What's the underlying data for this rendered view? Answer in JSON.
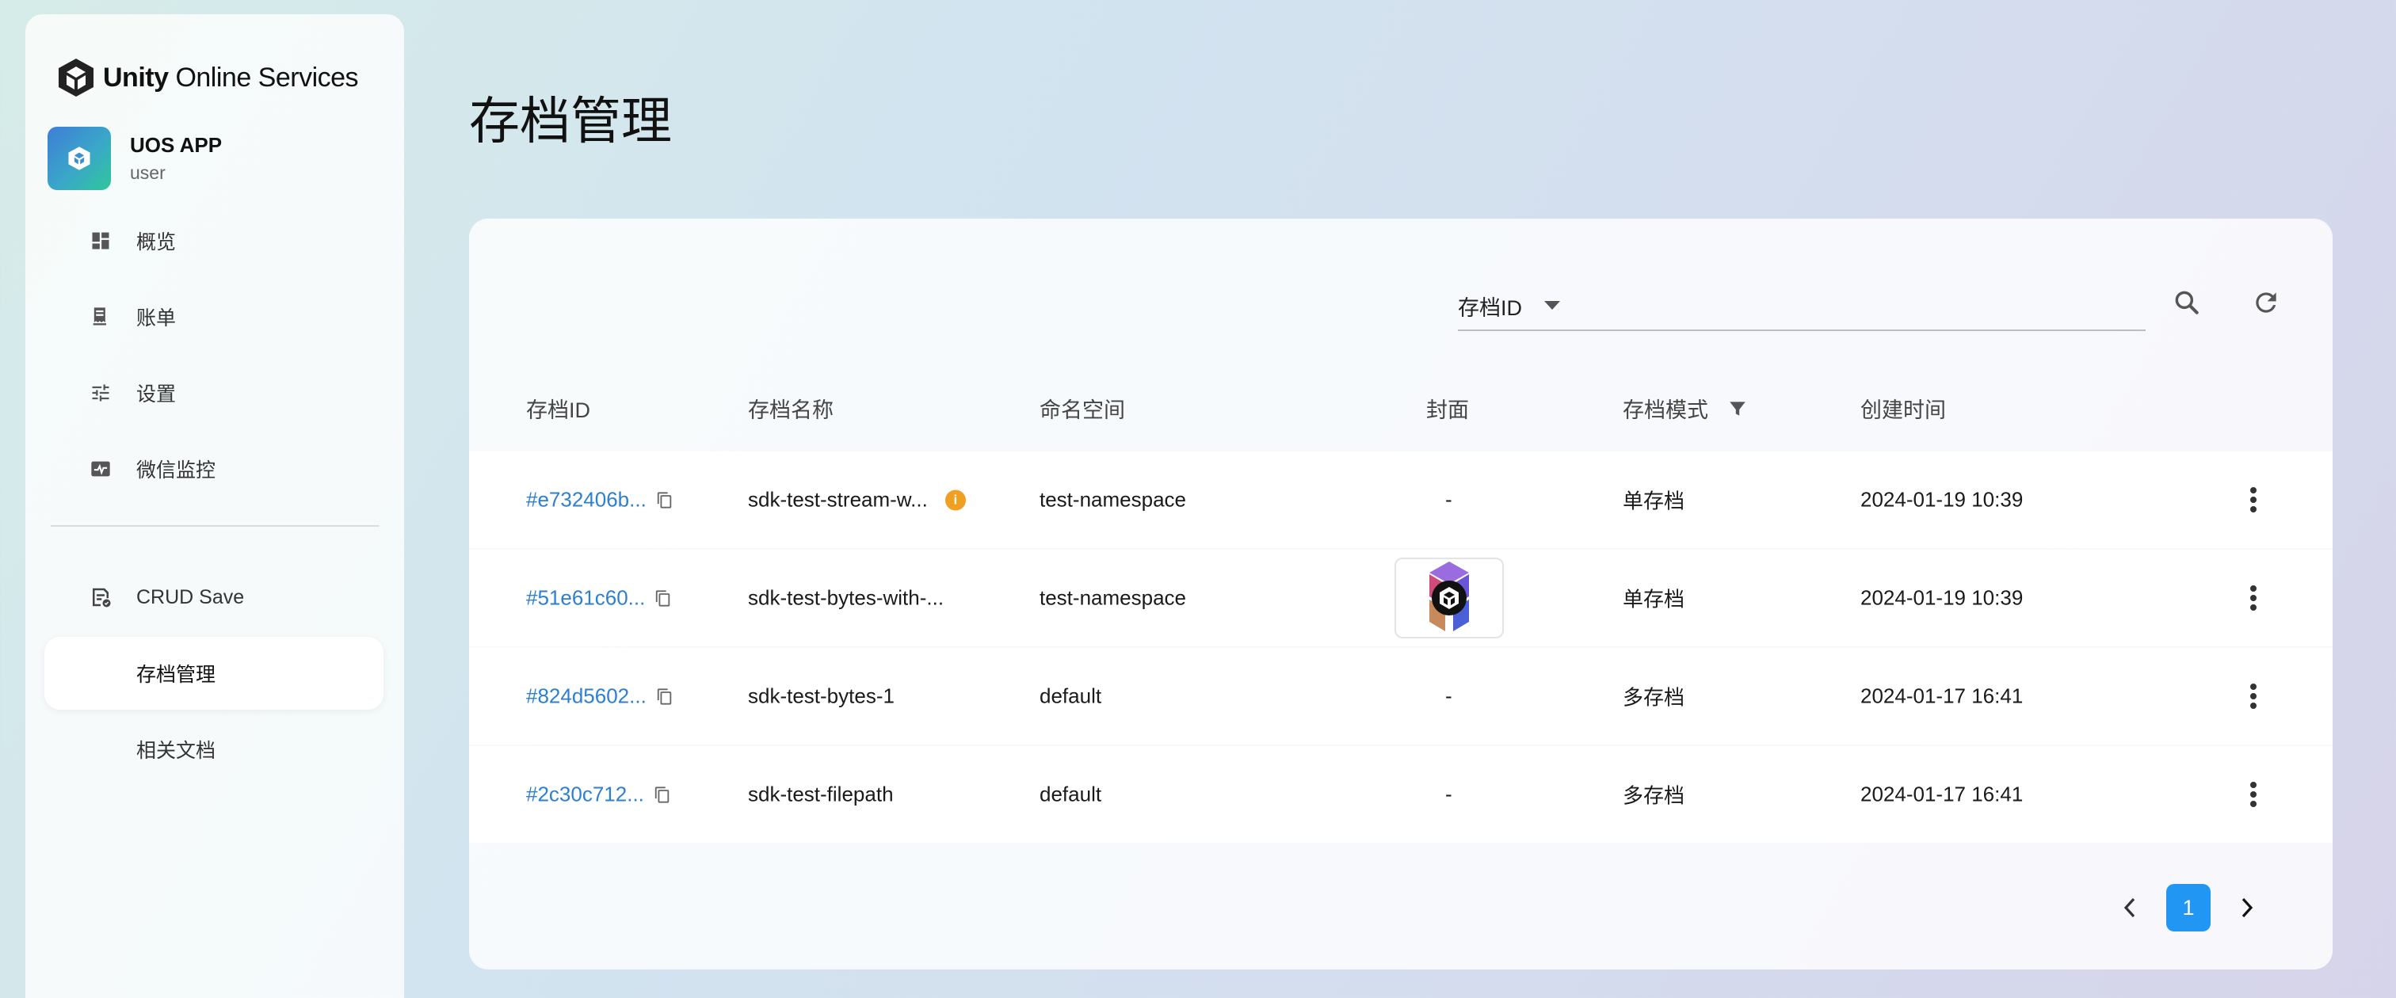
{
  "brand": {
    "name_bold": "Unity",
    "name_rest": " Online Services"
  },
  "app": {
    "name": "UOS APP",
    "role": "user"
  },
  "sidebar": {
    "items": [
      {
        "label": "概览",
        "icon": "dashboard-icon"
      },
      {
        "label": "账单",
        "icon": "receipt-icon"
      },
      {
        "label": "设置",
        "icon": "tune-icon"
      },
      {
        "label": "微信监控",
        "icon": "monitor-icon"
      }
    ],
    "section": {
      "label": "CRUD Save",
      "icon": "save-app-icon"
    },
    "sub_items": [
      {
        "label": "存档管理",
        "active": true
      },
      {
        "label": "相关文档",
        "active": false
      }
    ]
  },
  "page": {
    "title": "存档管理"
  },
  "search": {
    "field": "存档ID",
    "value": ""
  },
  "table": {
    "headers": [
      "存档ID",
      "存档名称",
      "命名空间",
      "封面",
      "存档模式",
      "创建时间"
    ],
    "rows": [
      {
        "id": "#e732406b...",
        "name": "sdk-test-stream-w...",
        "has_info": true,
        "namespace": "test-namespace",
        "cover": "-",
        "mode": "单存档",
        "created": "2024-01-19 10:39"
      },
      {
        "id": "#51e61c60...",
        "name": "sdk-test-bytes-with-...",
        "has_info": false,
        "namespace": "test-namespace",
        "cover": "image",
        "mode": "单存档",
        "created": "2024-01-19 10:39"
      },
      {
        "id": "#824d5602...",
        "name": "sdk-test-bytes-1",
        "has_info": false,
        "namespace": "default",
        "cover": "-",
        "mode": "多存档",
        "created": "2024-01-17 16:41"
      },
      {
        "id": "#2c30c712...",
        "name": "sdk-test-filepath",
        "has_info": false,
        "namespace": "default",
        "cover": "-",
        "mode": "多存档",
        "created": "2024-01-17 16:41"
      }
    ]
  },
  "pagination": {
    "current": "1"
  },
  "colors": {
    "accent": "#2196f3",
    "link": "#2d7fd1",
    "warning": "#f0a020"
  }
}
